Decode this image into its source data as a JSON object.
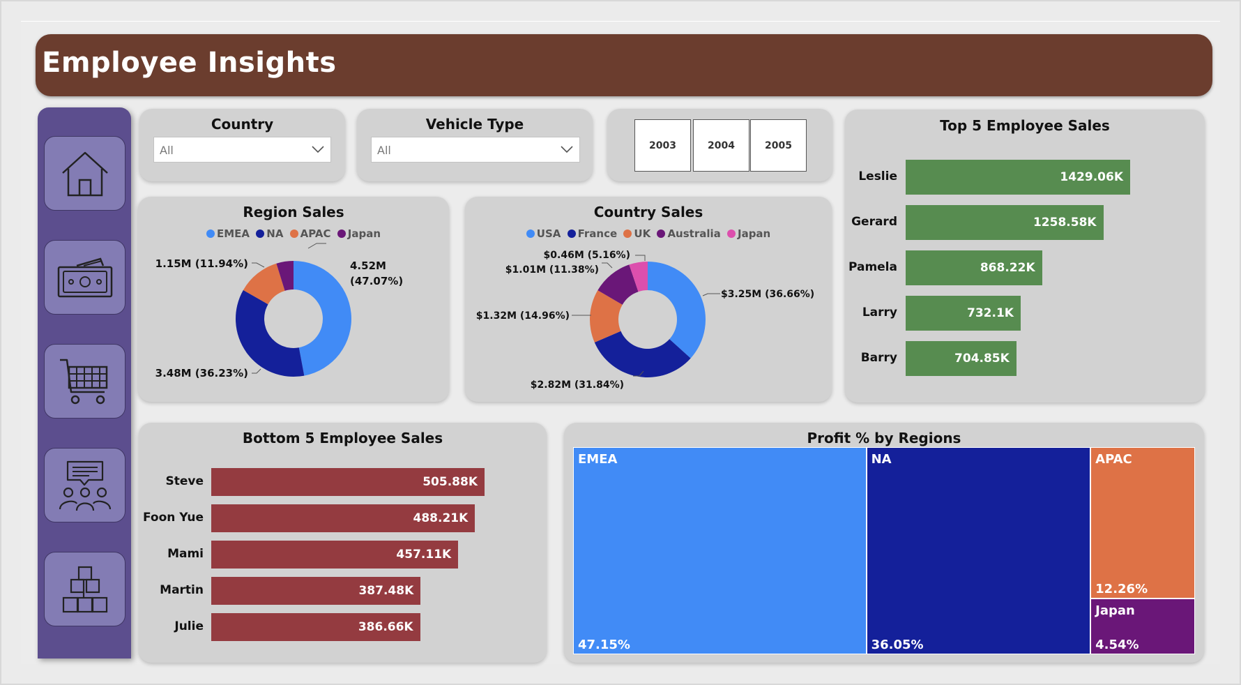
{
  "header": {
    "title": "Employee Insights"
  },
  "sidebar": {
    "items": [
      {
        "icon": "home-icon",
        "label": "Home"
      },
      {
        "icon": "money-icon",
        "label": "Sales"
      },
      {
        "icon": "cart-icon",
        "label": "Orders"
      },
      {
        "icon": "employees-icon",
        "label": "Employees"
      },
      {
        "icon": "boxes-icon",
        "label": "Products"
      }
    ]
  },
  "filters": {
    "country": {
      "title": "Country",
      "value": "All"
    },
    "vehicle_type": {
      "title": "Vehicle Type",
      "value": "All"
    },
    "years": [
      "2003",
      "2004",
      "2005"
    ]
  },
  "region_sales": {
    "title": "Region Sales",
    "legend": [
      {
        "name": "EMEA",
        "color": "#418bf6"
      },
      {
        "name": "NA",
        "color": "#14209a"
      },
      {
        "name": "APAC",
        "color": "#de7246"
      },
      {
        "name": "Japan",
        "color": "#6a1778"
      }
    ],
    "labels": {
      "emea_a": "4.52M",
      "emea_b": "(47.07%)",
      "na": "3.48M (36.23%)",
      "apac": "1.15M (11.94%)"
    }
  },
  "country_sales": {
    "title": "Country Sales",
    "legend": [
      {
        "name": "USA",
        "color": "#418bf6"
      },
      {
        "name": "France",
        "color": "#14209a"
      },
      {
        "name": "UK",
        "color": "#de7246"
      },
      {
        "name": "Australia",
        "color": "#6a1778"
      },
      {
        "name": "Japan",
        "color": "#dc4fad"
      }
    ],
    "labels": {
      "usa": "$3.25M (36.66%)",
      "france": "$2.82M (31.84%)",
      "uk": "$1.32M (14.96%)",
      "australia": "$1.01M (11.38%)",
      "japan": "$0.46M (5.16%)"
    }
  },
  "top5": {
    "title": "Top 5 Employee Sales",
    "rows": [
      {
        "name": "Leslie",
        "value": "1429.06K"
      },
      {
        "name": "Gerard",
        "value": "1258.58K"
      },
      {
        "name": "Pamela",
        "value": "868.22K"
      },
      {
        "name": "Larry",
        "value": "732.1K"
      },
      {
        "name": "Barry",
        "value": "704.85K"
      }
    ]
  },
  "bottom5": {
    "title": "Bottom 5 Employee Sales",
    "rows": [
      {
        "name": "Steve",
        "value": "505.88K"
      },
      {
        "name": "Foon Yue",
        "value": "488.21K"
      },
      {
        "name": "Mami",
        "value": "457.11K"
      },
      {
        "name": "Martin",
        "value": "387.48K"
      },
      {
        "name": "Julie",
        "value": "386.66K"
      }
    ]
  },
  "profit": {
    "title": "Profit % by Regions",
    "cells": [
      {
        "name": "EMEA",
        "value": "47.15%",
        "color": "#418bf6"
      },
      {
        "name": "NA",
        "value": "36.05%",
        "color": "#14209a"
      },
      {
        "name": "APAC",
        "value": "12.26%",
        "color": "#de7246"
      },
      {
        "name": "Japan",
        "value": "4.54%",
        "color": "#6a1778"
      }
    ]
  },
  "chart_data": [
    {
      "type": "pie",
      "title": "Region Sales",
      "categories": [
        "EMEA",
        "NA",
        "APAC",
        "Japan"
      ],
      "values": [
        4.52,
        3.48,
        1.15,
        0.46
      ],
      "percent": [
        47.07,
        36.23,
        11.94,
        4.76
      ],
      "unit": "M",
      "legend": "top"
    },
    {
      "type": "pie",
      "title": "Country Sales",
      "categories": [
        "USA",
        "France",
        "UK",
        "Australia",
        "Japan"
      ],
      "values": [
        3.25,
        2.82,
        1.32,
        1.01,
        0.46
      ],
      "percent": [
        36.66,
        31.84,
        14.96,
        11.38,
        5.16
      ],
      "unit": "$M",
      "legend": "top"
    },
    {
      "type": "bar",
      "title": "Top 5 Employee Sales",
      "categories": [
        "Leslie",
        "Gerard",
        "Pamela",
        "Larry",
        "Barry"
      ],
      "values": [
        1429.06,
        1258.58,
        868.22,
        732.1,
        704.85
      ],
      "unit": "K",
      "orientation": "horizontal"
    },
    {
      "type": "bar",
      "title": "Bottom 5 Employee Sales",
      "categories": [
        "Steve",
        "Foon Yue",
        "Mami",
        "Martin",
        "Julie"
      ],
      "values": [
        505.88,
        488.21,
        457.11,
        387.48,
        386.66
      ],
      "unit": "K",
      "orientation": "horizontal"
    },
    {
      "type": "treemap",
      "title": "Profit % by Regions",
      "categories": [
        "EMEA",
        "NA",
        "APAC",
        "Japan"
      ],
      "values": [
        47.15,
        36.05,
        12.26,
        4.54
      ],
      "unit": "%"
    }
  ]
}
